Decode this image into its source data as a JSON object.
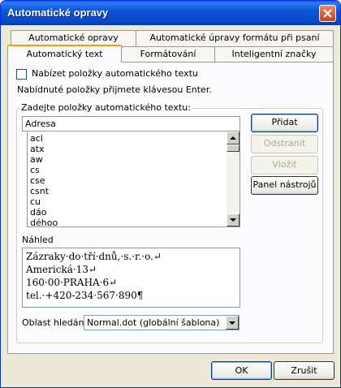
{
  "window": {
    "title": "Automatické opravy"
  },
  "tabs": {
    "row1": [
      "Automatické opravy",
      "Automatické úpravy formátu při psaní"
    ],
    "row2": [
      "Automatický text",
      "Formátování",
      "Inteligentní značky"
    ]
  },
  "options": {
    "offer_label": "Nabízet položky automatického textu",
    "offer_checked": false,
    "hint": "Nabídnuté položky přijmete klávesou Enter."
  },
  "entry": {
    "group_label": "Zadejte položky automatického textu:",
    "input_value": "Adresa",
    "list": [
      "acl",
      "atx",
      "aw",
      "cs",
      "cse",
      "csnt",
      "cu",
      "dáo",
      "déhoo"
    ]
  },
  "buttons": {
    "add": "Přidat",
    "delete": "Odstranit",
    "insert": "Vložit",
    "toolbar": "Panel nástrojů",
    "ok": "OK",
    "cancel": "Zrušit"
  },
  "preview": {
    "label": "Náhled",
    "lines": [
      "Zázraky·do·tří·dnů,·s.·r.·o.↵",
      "Americká·13↵",
      "160·00·PRAHA·6↵",
      "tel.·+420-234·567·890¶"
    ]
  },
  "lookin": {
    "label": "Oblast hledání:",
    "value": "Normal.dot (globální šablona)"
  }
}
